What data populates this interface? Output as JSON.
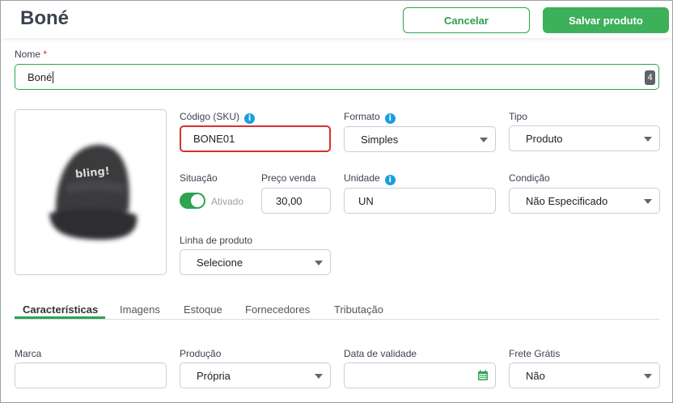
{
  "header": {
    "title": "Boné",
    "cancel_label": "Cancelar",
    "save_label": "Salvar produto"
  },
  "name_field": {
    "label": "Nome",
    "required_mark": "*",
    "value": "Boné",
    "counter": "4"
  },
  "form": {
    "sku": {
      "label": "Código (SKU)",
      "value": "BONE01"
    },
    "formato": {
      "label": "Formato",
      "value": "Simples"
    },
    "tipo": {
      "label": "Tipo",
      "value": "Produto"
    },
    "situacao": {
      "label": "Situação",
      "toggle_text": "Ativado",
      "enabled": true
    },
    "preco": {
      "label": "Preço venda",
      "value": "30,00"
    },
    "unidade": {
      "label": "Unidade",
      "value": "UN"
    },
    "condicao": {
      "label": "Condição",
      "value": "Não Especificado"
    },
    "linha": {
      "label": "Linha de produto",
      "value": "Selecione"
    },
    "info_glyph": "i"
  },
  "tabs": [
    {
      "label": "Características",
      "active": true
    },
    {
      "label": "Imagens",
      "active": false
    },
    {
      "label": "Estoque",
      "active": false
    },
    {
      "label": "Fornecedores",
      "active": false
    },
    {
      "label": "Tributação",
      "active": false
    }
  ],
  "details": {
    "marca": {
      "label": "Marca",
      "value": ""
    },
    "producao": {
      "label": "Produção",
      "value": "Própria"
    },
    "validade": {
      "label": "Data de validade",
      "value": ""
    },
    "frete": {
      "label": "Frete Grátis",
      "value": "Não"
    }
  },
  "product_image": {
    "alt": "Boné",
    "cap_text": "bling!"
  },
  "colors": {
    "accent": "#3db05a",
    "error": "#d62f2f",
    "info": "#1a9de0"
  },
  "icons": {
    "info": "info-icon",
    "calendar": "calendar-icon",
    "dropdown": "chevron-down-icon"
  }
}
